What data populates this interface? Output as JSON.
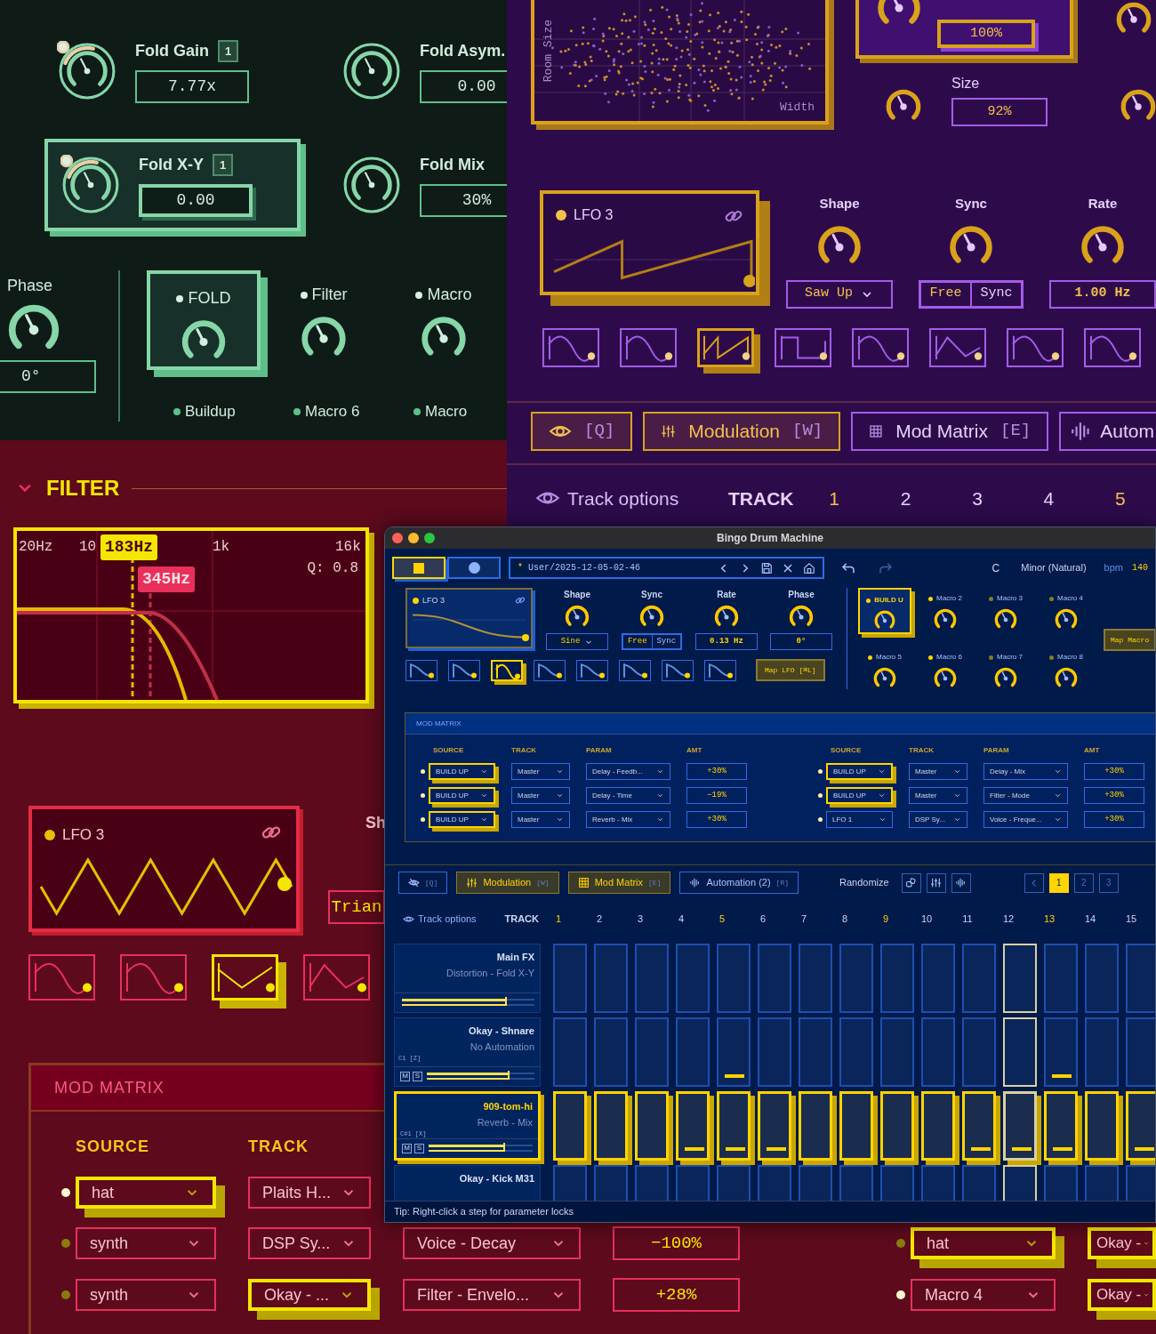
{
  "green": {
    "params": [
      {
        "label": "Fold Gain",
        "badge": "1",
        "value": "7.77x",
        "modulated": true,
        "selected": false
      },
      {
        "label": "Fold Asym.",
        "value": "0.00",
        "modulated": false,
        "selected": false
      },
      {
        "label": "Fold X-Y",
        "badge": "1",
        "value": "0.00",
        "modulated": true,
        "selected": true
      },
      {
        "label": "Fold Mix",
        "value": "30%",
        "modulated": false,
        "selected": false
      }
    ],
    "phase": {
      "label": "Phase",
      "value": "0°"
    },
    "macros": [
      {
        "label": "FOLD",
        "selected": true
      },
      {
        "label": "Filter",
        "selected": false
      },
      {
        "label": "Macro",
        "selected": false
      }
    ],
    "macros_row2": [
      {
        "label": "Buildup"
      },
      {
        "label": "Macro 6"
      },
      {
        "label": "Macro"
      }
    ]
  },
  "purple": {
    "scatter": {
      "ylabel": "Room Size",
      "xlabel": "Width"
    },
    "mix": {
      "value": "100%"
    },
    "size": {
      "label": "Size",
      "value": "92%"
    },
    "lfo": {
      "title": "LFO 3",
      "kind": "saw"
    },
    "controls": [
      {
        "kind": "dropdown",
        "label": "Shape",
        "value": "Saw Up"
      },
      {
        "kind": "toggle",
        "label": "Sync",
        "options": [
          {
            "label": "Free",
            "selected": true
          },
          {
            "label": "Sync",
            "selected": false
          }
        ]
      },
      {
        "kind": "field",
        "label": "Rate",
        "value": "1.00 Hz"
      }
    ],
    "shapes": [
      {
        "kind": "sine",
        "selected": false
      },
      {
        "kind": "sine",
        "selected": false
      },
      {
        "kind": "saw",
        "selected": true
      },
      {
        "kind": "square",
        "selected": false
      },
      {
        "kind": "sine",
        "selected": false
      },
      {
        "kind": "peak",
        "selected": false
      },
      {
        "kind": "sine",
        "selected": false
      },
      {
        "kind": "sine",
        "selected": false
      }
    ],
    "tabs": [
      {
        "kind": "eye",
        "key": "[Q]",
        "selected": true
      },
      {
        "kind": "sliders",
        "label": "Modulation",
        "key": "[W]",
        "selected": true
      },
      {
        "kind": "grid",
        "label": "Mod Matrix",
        "key": "[E]",
        "selected": false
      },
      {
        "kind": "wave",
        "label": "Autom",
        "selected": false
      }
    ],
    "track_header": {
      "options": "Track options",
      "track": "TRACK",
      "steps": [
        {
          "label": "1",
          "accent": true
        },
        {
          "label": "2",
          "accent": false
        },
        {
          "label": "3",
          "accent": false
        },
        {
          "label": "4",
          "accent": false
        },
        {
          "label": "5",
          "accent": true
        }
      ]
    }
  },
  "red": {
    "section": "FILTER",
    "filter": {
      "labels": [
        "20Hz",
        "10",
        "1k",
        "16k"
      ],
      "q": "Q: 0.8",
      "markers": [
        {
          "label": "183Hz",
          "kind": "primary"
        },
        {
          "label": "345Hz",
          "kind": "secondary"
        }
      ]
    },
    "lfo": {
      "title": "LFO 3",
      "kind": "zigzag"
    },
    "side_label": "Sh",
    "side_value": "Trian",
    "shapes": [
      {
        "kind": "sine",
        "selected": false
      },
      {
        "kind": "sine",
        "selected": false
      },
      {
        "kind": "vee",
        "selected": true
      },
      {
        "kind": "peak",
        "selected": false
      }
    ],
    "matrix": {
      "title": "MOD MATRIX",
      "headings": [
        "SOURCE",
        "TRACK"
      ],
      "rows": [
        {
          "active": true,
          "source": {
            "value": "hat",
            "selected": true
          },
          "track": {
            "value": "Plaits H...",
            "selected": false
          }
        },
        {
          "active": false,
          "source": {
            "value": "synth",
            "selected": false
          },
          "track": {
            "value": "DSP Sy...",
            "selected": false
          },
          "param": {
            "value": "Voice - Decay",
            "selected": false
          },
          "amt": "−100%",
          "active2": false,
          "source2": {
            "value": "hat",
            "selected": true
          },
          "track2": {
            "value": "Okay -",
            "selected": true
          }
        },
        {
          "active": false,
          "source": {
            "value": "synth",
            "selected": false
          },
          "track": {
            "value": "Okay - ...",
            "selected": true
          },
          "param": {
            "value": "Filter - Envelo...",
            "selected": false
          },
          "amt": "+28%",
          "active2": true,
          "source2": {
            "value": "Macro 4",
            "selected": false
          },
          "track2": {
            "value": "Okay -",
            "selected": true
          }
        }
      ]
    }
  },
  "window": {
    "title": "Bingo Drum Machine",
    "transport": [
      {
        "kind": "stop",
        "selected": true
      },
      {
        "kind": "record",
        "selected": false
      }
    ],
    "path_mark": "*",
    "path": "User/2025-12-05-02-46",
    "key": "C",
    "scale": "Minor (Natural)",
    "bpm_label": "bpm",
    "bpm": "140",
    "lfo": {
      "title": "LFO 3",
      "kind": "fall"
    },
    "controls": [
      {
        "kind": "dropdown",
        "label": "Shape",
        "value": "Sine"
      },
      {
        "kind": "toggle",
        "label": "Sync",
        "options": [
          {
            "label": "Free",
            "selected": true
          },
          {
            "label": "Sync",
            "selected": false
          }
        ]
      },
      {
        "kind": "field",
        "label": "Rate",
        "value": "0.13 Hz"
      },
      {
        "kind": "field",
        "label": "Phase",
        "value": "0°"
      }
    ],
    "shapes": [
      {
        "kind": "fall",
        "selected": false
      },
      {
        "kind": "fall",
        "selected": false
      },
      {
        "kind": "sine",
        "selected": true
      },
      {
        "kind": "fall",
        "selected": false
      },
      {
        "kind": "fall",
        "selected": false
      },
      {
        "kind": "fall",
        "selected": false
      },
      {
        "kind": "fall",
        "selected": false
      },
      {
        "kind": "fall",
        "selected": false
      }
    ],
    "map_lfo": "Map LFO [⌘L]",
    "macros": [
      {
        "label": "BUILD U",
        "selected": true,
        "active": true
      },
      {
        "label": "Macro 2",
        "selected": false,
        "active": true
      },
      {
        "label": "Macro 3",
        "selected": false,
        "active": false
      },
      {
        "label": "Macro 4",
        "selected": false,
        "active": false
      },
      {
        "label": "Macro 5",
        "selected": false,
        "active": true
      },
      {
        "label": "Macro 6",
        "selected": false,
        "active": true
      },
      {
        "label": "Macro 7",
        "selected": false,
        "active": false
      },
      {
        "label": "Macro 8",
        "selected": false,
        "active": false
      }
    ],
    "map_macro": "Map Macro",
    "matrix": {
      "title": "MOD MATRIX",
      "groups": [
        {
          "headings": [
            "SOURCE",
            "TRACK",
            "PARAM",
            "AMT"
          ],
          "rows": [
            {
              "active": true,
              "source": {
                "value": "BUILD UP",
                "selected": true
              },
              "track": "Master",
              "param": "Delay - Feedb...",
              "amt": "+30%"
            },
            {
              "active": true,
              "source": {
                "value": "BUILD UP",
                "selected": true
              },
              "track": "Master",
              "param": "Delay - Time",
              "amt": "−19%"
            },
            {
              "active": true,
              "source": {
                "value": "BUILD UP",
                "selected": true
              },
              "track": "Master",
              "param": "Reverb - Mix",
              "amt": "+30%"
            }
          ]
        },
        {
          "headings": [
            "SOURCE",
            "TRACK",
            "PARAM",
            "AMT"
          ],
          "rows": [
            {
              "active": true,
              "source": {
                "value": "BUILD UP",
                "selected": true
              },
              "track": "Master",
              "param": "Delay - Mix",
              "amt": "+30%"
            },
            {
              "active": true,
              "source": {
                "value": "BUILD UP",
                "selected": true
              },
              "track": "Master",
              "param": "Filter - Mode",
              "amt": "+30%"
            },
            {
              "active": true,
              "source": {
                "value": "LFO 1",
                "selected": false
              },
              "track": "DSP Sy...",
              "param": "Voice - Freque...",
              "amt": "+30%"
            }
          ]
        }
      ]
    },
    "tabs": [
      {
        "kind": "eye-off",
        "key": "[Q]",
        "selected": false
      },
      {
        "kind": "sliders",
        "label": "Modulation",
        "key": "[W]",
        "selected": true
      },
      {
        "kind": "grid",
        "label": "Mod Matrix",
        "key": "[E]",
        "selected": true
      },
      {
        "kind": "wave",
        "label": "Automation (2)",
        "key": "[R]",
        "selected": false
      }
    ],
    "randomize": {
      "label": "Randomize",
      "buttons": [
        {
          "kind": "dice"
        },
        {
          "kind": "sliders"
        },
        {
          "kind": "wave"
        }
      ]
    },
    "pages": [
      {
        "label": "1",
        "selected": true
      },
      {
        "label": "2",
        "selected": false
      },
      {
        "label": "3",
        "selected": false
      }
    ],
    "track_header": {
      "options": "Track options",
      "track": "TRACK",
      "steps": [
        {
          "label": "1",
          "accent": true
        },
        {
          "label": "2",
          "accent": false
        },
        {
          "label": "3",
          "accent": false
        },
        {
          "label": "4",
          "accent": false
        },
        {
          "label": "5",
          "accent": true
        },
        {
          "label": "6",
          "accent": false
        },
        {
          "label": "7",
          "accent": false
        },
        {
          "label": "8",
          "accent": false
        },
        {
          "label": "9",
          "accent": true
        },
        {
          "label": "10",
          "accent": false
        },
        {
          "label": "11",
          "accent": false
        },
        {
          "label": "12",
          "accent": false
        },
        {
          "label": "13",
          "accent": true
        },
        {
          "label": "14",
          "accent": false
        },
        {
          "label": "15",
          "accent": false
        }
      ]
    },
    "tracks": [
      {
        "name": "Main FX",
        "detail": "Distortion - Fold X-Y",
        "selected": false,
        "level": 0.78,
        "steps": [
          {
            "on": false,
            "note": false,
            "current": false
          },
          {
            "on": false,
            "note": false,
            "current": false
          },
          {
            "on": false,
            "note": false,
            "current": false
          },
          {
            "on": false,
            "note": false,
            "current": false
          },
          {
            "on": false,
            "note": false,
            "current": false
          },
          {
            "on": false,
            "note": false,
            "current": false
          },
          {
            "on": false,
            "note": false,
            "current": false
          },
          {
            "on": false,
            "note": false,
            "current": false
          },
          {
            "on": false,
            "note": false,
            "current": false
          },
          {
            "on": false,
            "note": false,
            "current": false
          },
          {
            "on": false,
            "note": false,
            "current": false
          },
          {
            "on": false,
            "note": false,
            "current": true
          },
          {
            "on": false,
            "note": false,
            "current": false
          },
          {
            "on": false,
            "note": false,
            "current": false
          },
          {
            "on": false,
            "note": false,
            "current": false
          }
        ]
      },
      {
        "name": "Okay - Shnare",
        "detail": "No Automation",
        "key": "C1 [Z]",
        "mute": "M",
        "solo": "S",
        "selected": false,
        "level": 0.75,
        "steps": [
          {
            "on": false,
            "note": false,
            "current": false
          },
          {
            "on": false,
            "note": false,
            "current": false
          },
          {
            "on": false,
            "note": false,
            "current": false
          },
          {
            "on": false,
            "note": false,
            "current": false
          },
          {
            "on": false,
            "note": true,
            "current": false
          },
          {
            "on": false,
            "note": false,
            "current": false
          },
          {
            "on": false,
            "note": false,
            "current": false
          },
          {
            "on": false,
            "note": false,
            "current": false
          },
          {
            "on": false,
            "note": false,
            "current": false
          },
          {
            "on": false,
            "note": false,
            "current": false
          },
          {
            "on": false,
            "note": false,
            "current": false
          },
          {
            "on": false,
            "note": false,
            "current": true
          },
          {
            "on": false,
            "note": true,
            "current": false
          },
          {
            "on": false,
            "note": false,
            "current": false
          },
          {
            "on": false,
            "note": false,
            "current": false
          }
        ]
      },
      {
        "name": "909-tom-hi",
        "detail": "Reverb - Mix",
        "key": "C#1 [X]",
        "mute": "M",
        "solo": "S",
        "selected": true,
        "level": 0.72,
        "steps": [
          {
            "on": true,
            "note": false,
            "current": false
          },
          {
            "on": true,
            "note": false,
            "current": false
          },
          {
            "on": true,
            "note": false,
            "current": false
          },
          {
            "on": true,
            "note": true,
            "current": false
          },
          {
            "on": true,
            "note": true,
            "current": false
          },
          {
            "on": true,
            "note": true,
            "current": false
          },
          {
            "on": true,
            "note": false,
            "current": false
          },
          {
            "on": true,
            "note": false,
            "current": false
          },
          {
            "on": true,
            "note": false,
            "current": false
          },
          {
            "on": true,
            "note": false,
            "current": false
          },
          {
            "on": true,
            "note": true,
            "current": false
          },
          {
            "on": true,
            "note": true,
            "current": true
          },
          {
            "on": true,
            "note": true,
            "current": false
          },
          {
            "on": true,
            "note": false,
            "current": false
          },
          {
            "on": true,
            "note": true,
            "current": false
          }
        ]
      },
      {
        "name": "Okay - Kick M31",
        "selected": false,
        "steps": [
          {
            "on": false,
            "note": false,
            "current": false
          },
          {
            "on": false,
            "note": false,
            "current": false
          },
          {
            "on": false,
            "note": false,
            "current": false
          },
          {
            "on": false,
            "note": false,
            "current": false
          },
          {
            "on": false,
            "note": false,
            "current": false
          },
          {
            "on": false,
            "note": false,
            "current": false
          },
          {
            "on": false,
            "note": false,
            "current": false
          },
          {
            "on": false,
            "note": false,
            "current": false
          },
          {
            "on": false,
            "note": false,
            "current": false
          },
          {
            "on": false,
            "note": false,
            "current": false
          },
          {
            "on": false,
            "note": false,
            "current": false
          },
          {
            "on": false,
            "note": false,
            "current": true
          },
          {
            "on": false,
            "note": false,
            "current": false
          },
          {
            "on": false,
            "note": false,
            "current": false
          },
          {
            "on": false,
            "note": false,
            "current": false
          }
        ]
      }
    ],
    "tip": "Tip: Right-click a step for parameter locks"
  }
}
